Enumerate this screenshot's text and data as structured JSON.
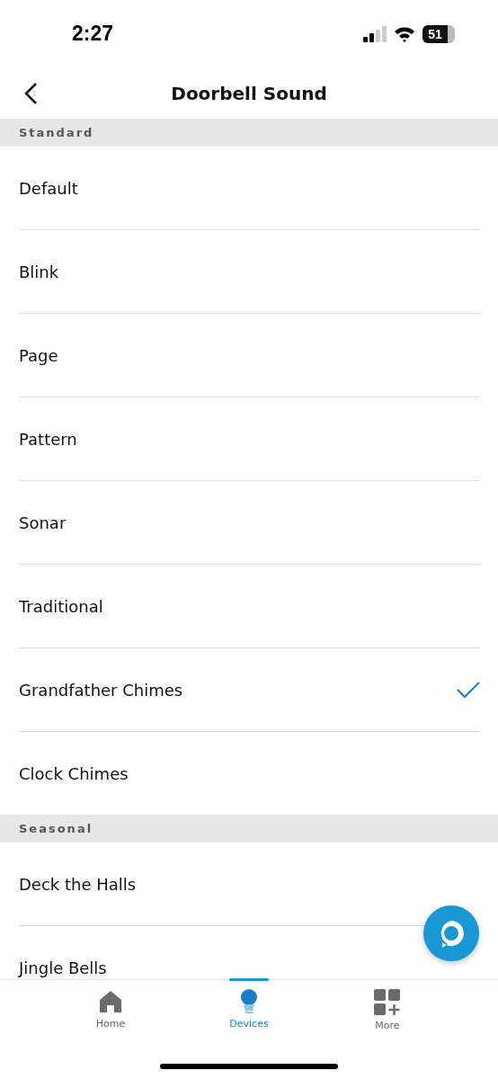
{
  "status_bar": {
    "time": "2:27",
    "battery": "51"
  },
  "header": {
    "title": "Doorbell Sound"
  },
  "sections": [
    {
      "title": "Standard",
      "items": [
        {
          "label": "Default",
          "selected": false
        },
        {
          "label": "Blink",
          "selected": false
        },
        {
          "label": "Page",
          "selected": false
        },
        {
          "label": "Pattern",
          "selected": false
        },
        {
          "label": "Sonar",
          "selected": false
        },
        {
          "label": "Traditional",
          "selected": false
        },
        {
          "label": "Grandfather Chimes",
          "selected": true
        },
        {
          "label": "Clock Chimes",
          "selected": false
        }
      ]
    },
    {
      "title": "Seasonal",
      "items": [
        {
          "label": "Deck the Halls",
          "selected": false
        },
        {
          "label": "Jingle Bells",
          "selected": false
        }
      ]
    }
  ],
  "nav": [
    {
      "label": "Home",
      "kind": "home",
      "selected": false
    },
    {
      "label": "Devices",
      "kind": "devices",
      "selected": true
    },
    {
      "label": "More",
      "kind": "more",
      "selected": false
    }
  ]
}
